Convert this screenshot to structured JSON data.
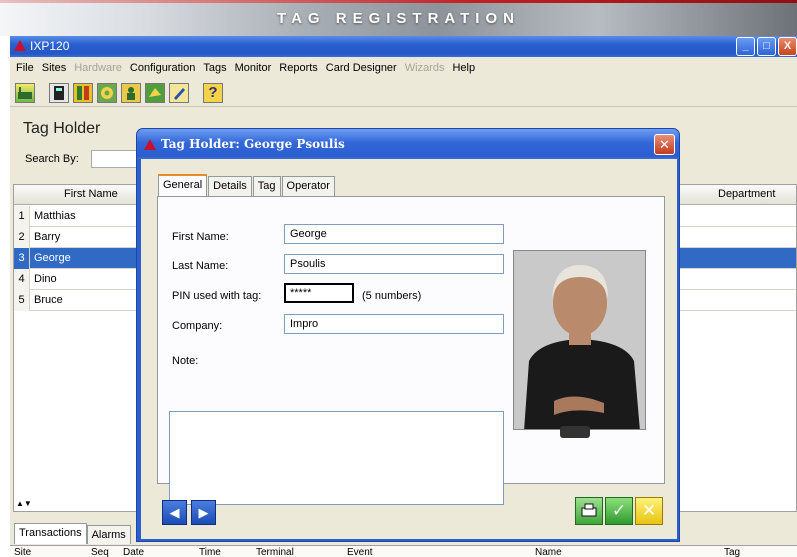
{
  "banner": {
    "title": "TAG REGISTRATION"
  },
  "app": {
    "title": "IXP120",
    "window_buttons": [
      "_",
      "□",
      "X"
    ],
    "menu": [
      {
        "label": "File",
        "enabled": true
      },
      {
        "label": "Sites",
        "enabled": true
      },
      {
        "label": "Hardware",
        "enabled": false
      },
      {
        "label": "Configuration",
        "enabled": true
      },
      {
        "label": "Tags",
        "enabled": true
      },
      {
        "label": "Monitor",
        "enabled": true
      },
      {
        "label": "Reports",
        "enabled": true
      },
      {
        "label": "Card Designer",
        "enabled": true
      },
      {
        "label": "Wizards",
        "enabled": false
      },
      {
        "label": "Help",
        "enabled": true
      }
    ],
    "toolbar_icons": [
      "factory-icon",
      "terminal-icon",
      "door-icon",
      "gear-icon",
      "person-icon",
      "map-icon",
      "pencil-icon",
      "help-icon"
    ],
    "help_glyph": "?"
  },
  "panel": {
    "title": "Tag Holder",
    "search_label": "Search By:",
    "columns": {
      "first_name": "First Name",
      "department": "Department"
    },
    "rows": [
      {
        "num": "1",
        "first_name": "Matthias"
      },
      {
        "num": "2",
        "first_name": "Barry"
      },
      {
        "num": "3",
        "first_name": "George",
        "selected": true
      },
      {
        "num": "4",
        "first_name": "Dino"
      },
      {
        "num": "5",
        "first_name": "Bruce"
      }
    ]
  },
  "bottom": {
    "tabs": [
      "Transactions",
      "Alarms"
    ],
    "columns": [
      "Site",
      "Seq",
      "Date",
      "Time",
      "Terminal",
      "Event",
      "Name",
      "Tag"
    ]
  },
  "dialog": {
    "title": "Tag Holder: George Psoulis",
    "tabs": [
      "General",
      "Details",
      "Tag",
      "Operator"
    ],
    "fields": {
      "first_name_label": "First Name:",
      "first_name": "George",
      "last_name_label": "Last Name:",
      "last_name": "Psoulis",
      "pin_label": "PIN used with tag:",
      "pin": "*****",
      "pin_hint": "(5 numbers)",
      "company_label": "Company:",
      "company": "Impro",
      "note_label": "Note:"
    }
  },
  "colors": {
    "selection": "#316ac5",
    "title_blue": "#2a5fd0",
    "accent_red": "#c8102e"
  }
}
